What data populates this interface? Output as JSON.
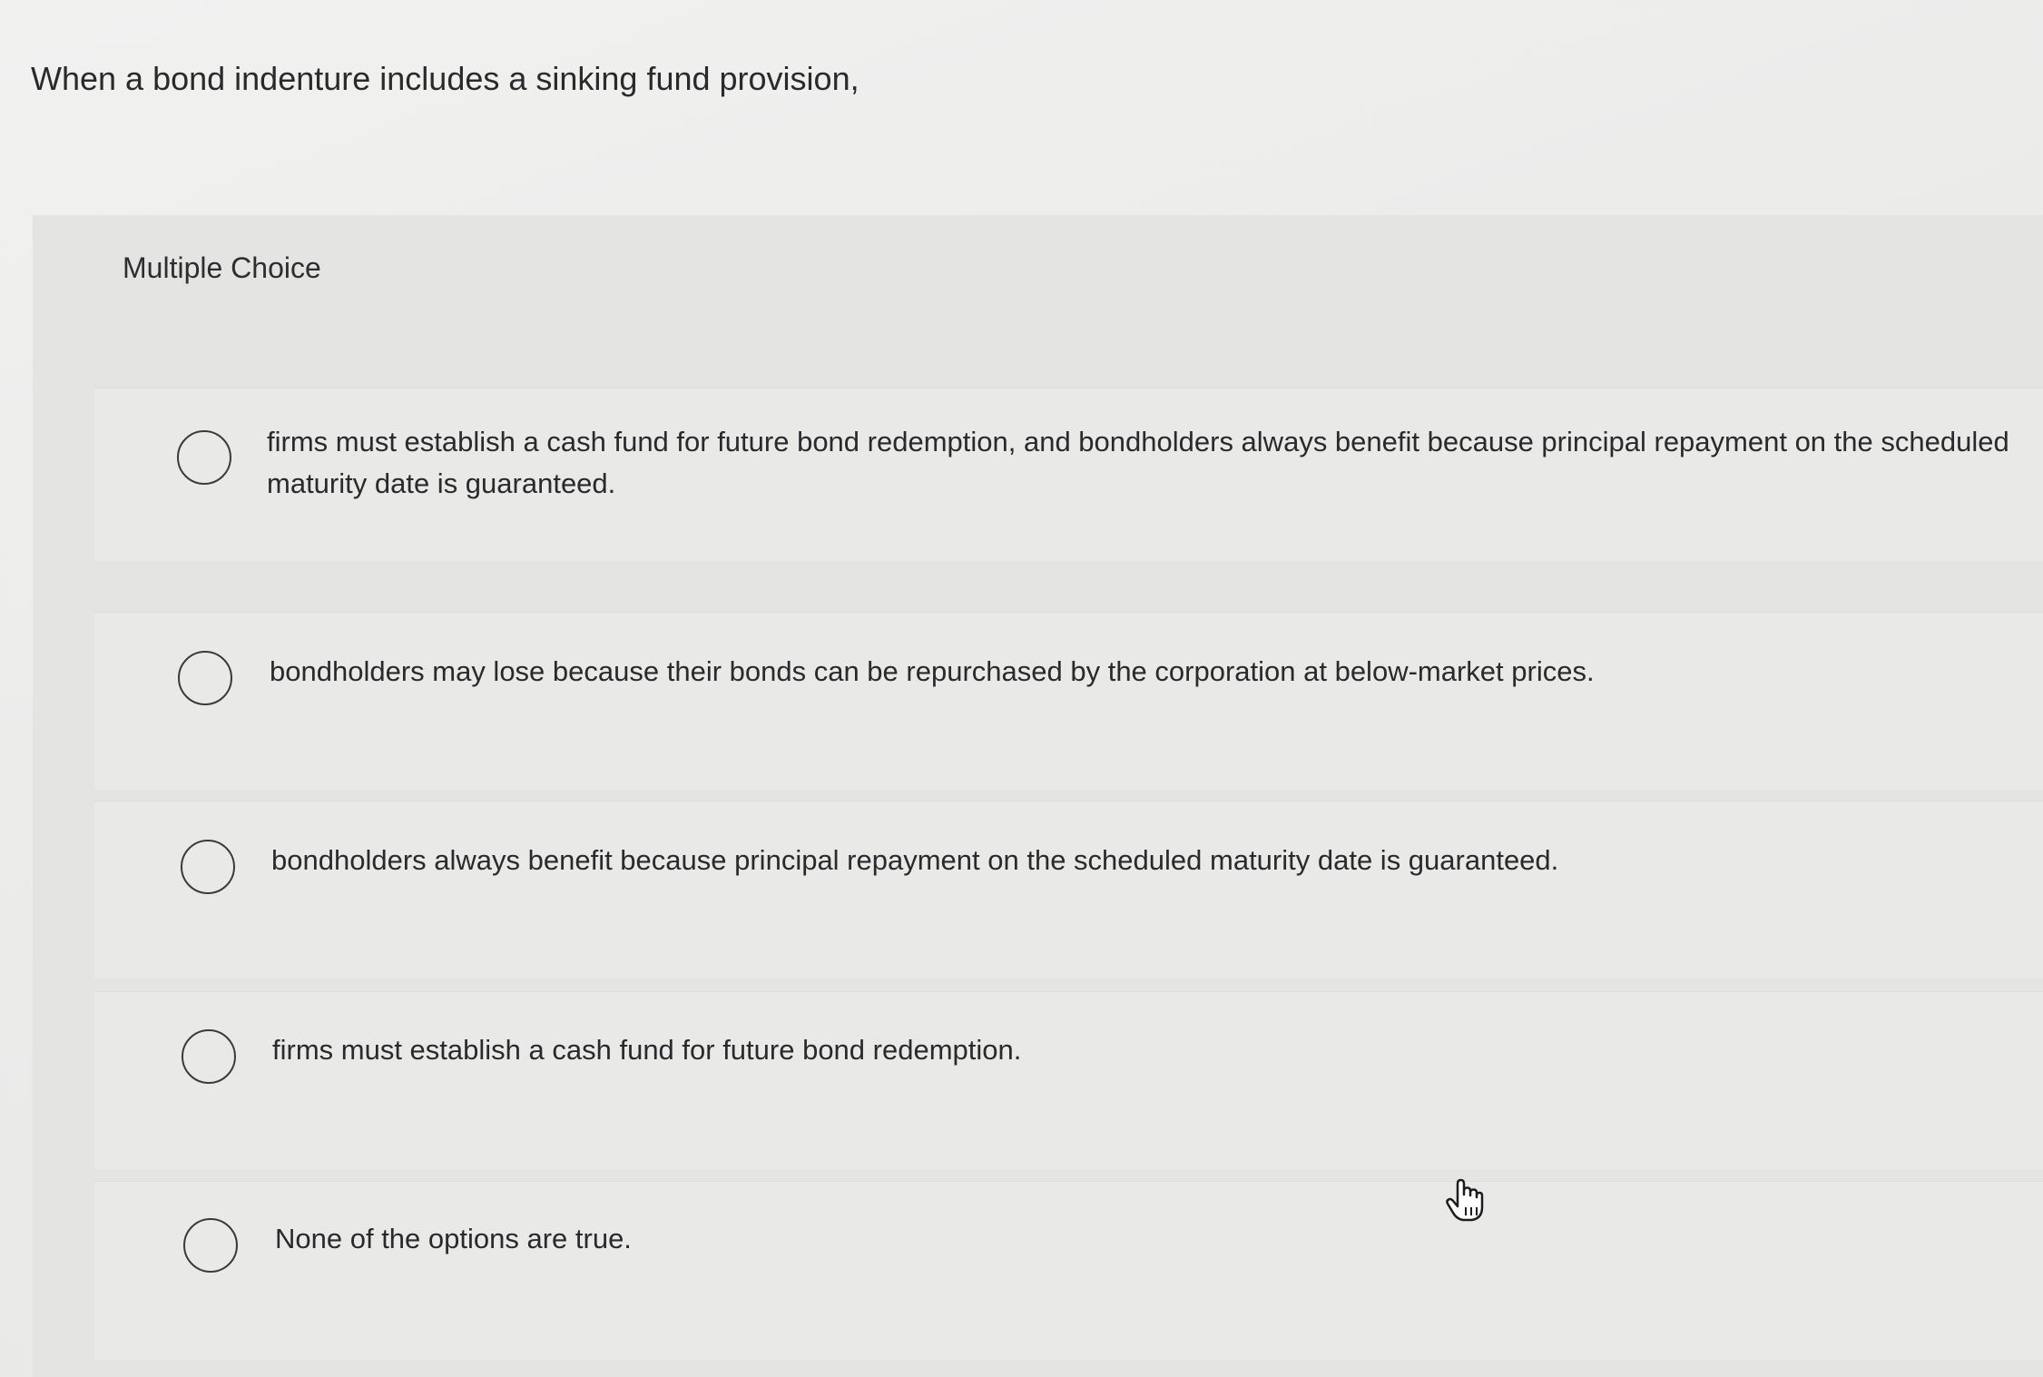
{
  "question": {
    "text": "When a bond indenture includes a sinking fund provision,"
  },
  "panel": {
    "header": "Multiple Choice"
  },
  "options": [
    {
      "label": "firms must establish a cash fund for future bond redemption, and bondholders always benefit because principal repayment on the scheduled maturity date is guaranteed.",
      "selected": false
    },
    {
      "label": "bondholders may lose because their bonds can be repurchased by the corporation at below-market prices.",
      "selected": false
    },
    {
      "label": "bondholders always benefit because principal repayment on the scheduled maturity date is guaranteed.",
      "selected": false
    },
    {
      "label": "firms must establish a cash fund for future bond redemption.",
      "selected": false
    },
    {
      "label": "None of the options are true.",
      "selected": false
    }
  ],
  "icons": {
    "radio": "radio-button-empty-icon",
    "cursor": "hand-pointer-icon"
  }
}
